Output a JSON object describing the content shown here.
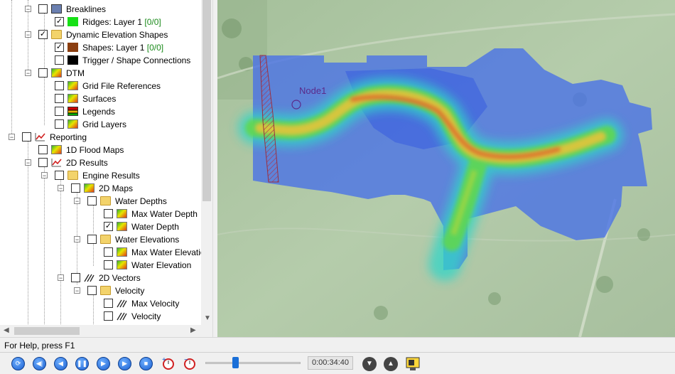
{
  "tree": {
    "items": [
      {
        "label": "Breaklines",
        "checked": false
      },
      {
        "label": "Ridges: Layer 1",
        "count": "[0/0]",
        "checked": true,
        "swatch": "#16e016"
      },
      {
        "label": "Dynamic Elevation Shapes",
        "checked": true
      },
      {
        "label": "Shapes: Layer 1",
        "count": "[0/0]",
        "checked": true,
        "swatch": "#8b3e10"
      },
      {
        "label": "Trigger / Shape Connections",
        "checked": false,
        "swatch": "#000000"
      },
      {
        "label": "DTM",
        "checked": false
      },
      {
        "label": "Grid File References",
        "checked": false
      },
      {
        "label": "Surfaces",
        "checked": false
      },
      {
        "label": "Legends",
        "checked": false
      },
      {
        "label": "Grid Layers",
        "checked": false
      },
      {
        "label": "Reporting",
        "checked": false
      },
      {
        "label": "1D Flood Maps",
        "checked": false
      },
      {
        "label": "2D Results",
        "checked": false
      },
      {
        "label": "Engine Results",
        "checked": false
      },
      {
        "label": "2D Maps",
        "checked": false
      },
      {
        "label": "Water Depths",
        "checked": false
      },
      {
        "label": "Max Water Depth",
        "checked": false
      },
      {
        "label": "Water Depth",
        "checked": true
      },
      {
        "label": "Water Elevations",
        "checked": false
      },
      {
        "label": "Max Water Elevation",
        "checked": false
      },
      {
        "label": "Water Elevation",
        "checked": false
      },
      {
        "label": "2D Vectors",
        "checked": false
      },
      {
        "label": "Velocity",
        "checked": false
      },
      {
        "label": "Max Velocity",
        "checked": false
      },
      {
        "label": "Velocity",
        "checked": false
      }
    ]
  },
  "map": {
    "node_label": "Node1"
  },
  "status": {
    "help_text": "For Help, press F1"
  },
  "playback": {
    "time": "0:00:34:40",
    "progress": 0.3
  }
}
